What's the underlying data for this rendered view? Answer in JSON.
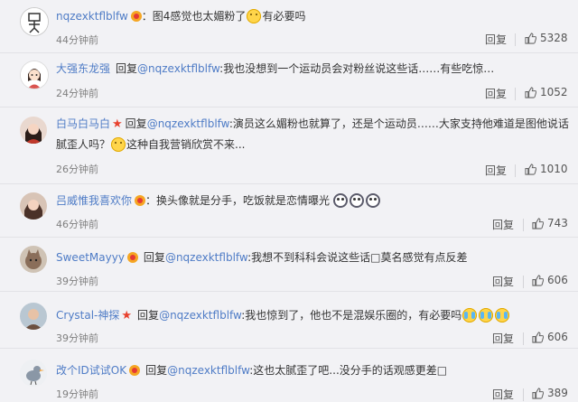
{
  "reply_label": "回复",
  "reply_prefix": "回复",
  "comments": [
    {
      "user": "nqzexktflblfw",
      "text_parts": [
        "：图4感觉也太媚粉了",
        "有必要吗"
      ],
      "time": "44分钟前",
      "likes": "5328",
      "avatar_icon": "stick-figure-avatar"
    },
    {
      "user": "大强东龙强",
      "mention": "@nqzexktflblfw",
      "text": ":我也没想到一个运动员会对粉丝说这些话……有些吃惊…",
      "time": "24分钟前",
      "likes": "1052",
      "avatar_icon": "cartoon-girl-avatar"
    },
    {
      "user": "白马白马白",
      "mention": "@nqzexktflblfw",
      "text": ":演员这么媚粉也就算了，还是个运动员……大家支持他难道是图他说话",
      "text_line2": "腻歪人吗？",
      "text_line2_after": "这种自我营销欣赏不来...",
      "time": "26分钟前",
      "likes": "1010",
      "avatar_icon": "woman-photo-avatar"
    },
    {
      "user": "吕威惟我喜欢你",
      "text": "：换头像就是分手，吃饭就是恋情曝光",
      "time": "46分钟前",
      "likes": "743",
      "avatar_icon": "woman-photo-avatar"
    },
    {
      "user": "SweetMayyy",
      "mention": "@nqzexktflblfw",
      "text": ":我想不到科科会说这些话□莫名感觉有点反差",
      "time": "39分钟前",
      "likes": "606",
      "avatar_icon": "cat-avatar"
    },
    {
      "user": "Crystal-神探",
      "mention": "@nqzexktflblfw",
      "text": ":我也惊到了，他也不是混娱乐圈的，有必要吗",
      "time": "39分钟前",
      "likes": "606",
      "avatar_icon": "portrait-avatar"
    },
    {
      "user": "改个ID试试OK",
      "mention": "@nqzexktflblfw",
      "text": ":这也太腻歪了吧...没分手的话观感更差□",
      "time": "19分钟前",
      "likes": "389",
      "avatar_icon": "bird-avatar"
    }
  ]
}
